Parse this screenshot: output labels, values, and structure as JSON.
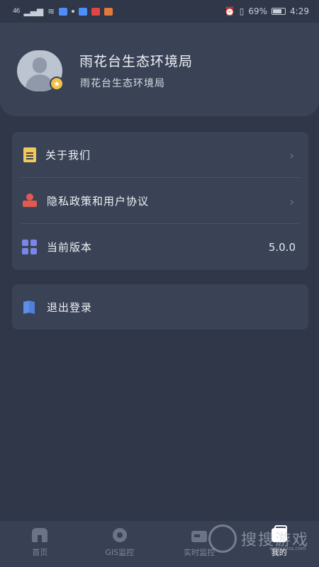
{
  "status_bar": {
    "signal": "46",
    "battery_percent": "69%",
    "time": "4:29",
    "app_icon_colors": [
      "#4f8ef7",
      "#e04646",
      "#e07a3a"
    ]
  },
  "profile": {
    "name": "雨花台生态环境局",
    "subtitle": "雨花台生态环境局",
    "avatar_icon": "user-silhouette",
    "badge_icon": "star"
  },
  "menu": {
    "items": [
      {
        "label": "关于我们",
        "icon": "document-icon",
        "icon_color": "#f2c85b",
        "chevron": "›"
      },
      {
        "label": "隐私政策和用户协议",
        "icon": "stamp-icon",
        "icon_color": "#e05a4f",
        "chevron": "›"
      },
      {
        "label": "当前版本",
        "icon": "grid-icon",
        "icon_color": "#7b86e8",
        "value": "5.0.0"
      }
    ]
  },
  "logout": {
    "label": "退出登录",
    "icon": "book-icon",
    "icon_color": "#5d8ee8"
  },
  "tabbar": {
    "tabs": [
      {
        "label": "首页",
        "icon": "home-icon",
        "active": false
      },
      {
        "label": "GIS监控",
        "icon": "camera-icon",
        "active": false
      },
      {
        "label": "实时监控",
        "icon": "monitor-icon",
        "active": false
      },
      {
        "label": "我的",
        "icon": "mine-icon",
        "active": true
      }
    ]
  },
  "watermark": {
    "text": "搜搜游戏",
    "url": "www.yxss.com"
  },
  "colors": {
    "background": "#2f3749",
    "card": "#3a4356",
    "tab_active": "#ffffff",
    "tab_inactive": "#7f899b"
  }
}
